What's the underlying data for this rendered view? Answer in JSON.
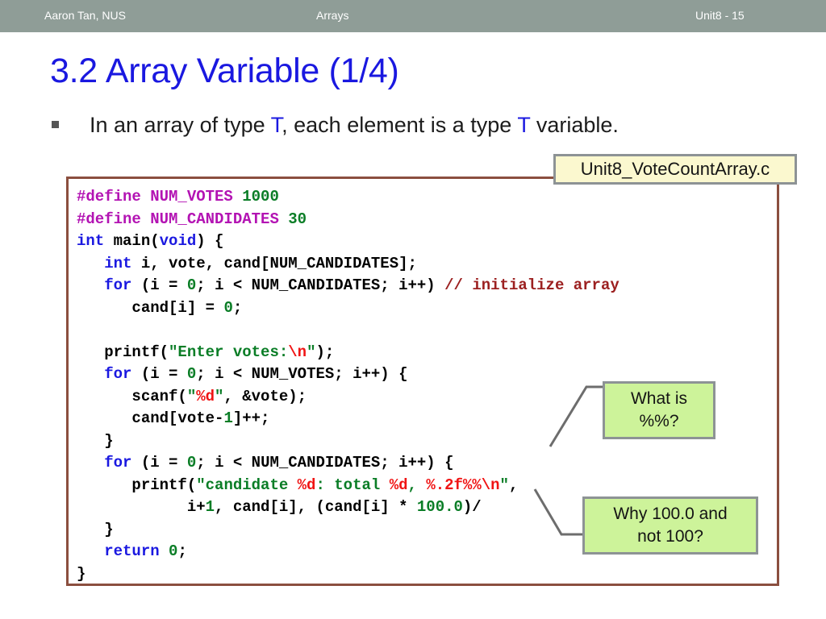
{
  "header": {
    "author": "Aaron Tan, NUS",
    "topic": "Arrays",
    "unit": "Unit8 - 15",
    "bar_color": "#8f9d97"
  },
  "title": {
    "number": "3.2",
    "text": "Array Variable (1/4)",
    "color": "#1a18e0"
  },
  "bullet": {
    "part1": "In an array of type ",
    "type1": "T",
    "part2": ", each element is a type ",
    "type2": "T",
    "part3": " variable.",
    "type_color": "#1a18e0"
  },
  "file_label": {
    "text": "Unit8_VoteCountArray.c",
    "background": "#fbf8cf",
    "border": "#8d9395"
  },
  "code": {
    "border_color": "#8b4f3f",
    "lines": [
      [
        {
          "t": "#define ",
          "c": "tok-pre"
        },
        {
          "t": "NUM_VOTES",
          "c": "tok-macro"
        },
        {
          "t": " ",
          "c": ""
        },
        {
          "t": "1000",
          "c": "tok-num"
        }
      ],
      [
        {
          "t": "#define ",
          "c": "tok-pre"
        },
        {
          "t": "NUM_CANDIDATES",
          "c": "tok-macro"
        },
        {
          "t": " ",
          "c": ""
        },
        {
          "t": "30",
          "c": "tok-num"
        }
      ],
      [
        {
          "t": "int",
          "c": "tok-kw"
        },
        {
          "t": " main(",
          "c": ""
        },
        {
          "t": "void",
          "c": "tok-kw"
        },
        {
          "t": ") {",
          "c": ""
        }
      ],
      [
        {
          "t": "   ",
          "c": ""
        },
        {
          "t": "int",
          "c": "tok-kw"
        },
        {
          "t": " i, vote, cand[NUM_CANDIDATES];",
          "c": ""
        }
      ],
      [
        {
          "t": "   ",
          "c": ""
        },
        {
          "t": "for",
          "c": "tok-kw"
        },
        {
          "t": " (i = ",
          "c": ""
        },
        {
          "t": "0",
          "c": "tok-num"
        },
        {
          "t": "; i < NUM_CANDIDATES; i++) ",
          "c": ""
        },
        {
          "t": "// initialize array",
          "c": "tok-cmt"
        }
      ],
      [
        {
          "t": "      cand[i] = ",
          "c": ""
        },
        {
          "t": "0",
          "c": "tok-num"
        },
        {
          "t": ";",
          "c": ""
        }
      ],
      [
        {
          "t": " ",
          "c": ""
        }
      ],
      [
        {
          "t": "   printf(",
          "c": ""
        },
        {
          "t": "\"Enter votes:",
          "c": "tok-str"
        },
        {
          "t": "\\n",
          "c": "tok-esc"
        },
        {
          "t": "\"",
          "c": "tok-str"
        },
        {
          "t": ");",
          "c": ""
        }
      ],
      [
        {
          "t": "   ",
          "c": ""
        },
        {
          "t": "for",
          "c": "tok-kw"
        },
        {
          "t": " (i = ",
          "c": ""
        },
        {
          "t": "0",
          "c": "tok-num"
        },
        {
          "t": "; i < NUM_VOTES; i++) {",
          "c": ""
        }
      ],
      [
        {
          "t": "      scanf(",
          "c": ""
        },
        {
          "t": "\"",
          "c": "tok-str"
        },
        {
          "t": "%d",
          "c": "tok-esc"
        },
        {
          "t": "\"",
          "c": "tok-str"
        },
        {
          "t": ", &vote);",
          "c": ""
        }
      ],
      [
        {
          "t": "      cand[vote-",
          "c": ""
        },
        {
          "t": "1",
          "c": "tok-num"
        },
        {
          "t": "]++;",
          "c": ""
        }
      ],
      [
        {
          "t": "   }",
          "c": ""
        }
      ],
      [
        {
          "t": "   ",
          "c": ""
        },
        {
          "t": "for",
          "c": "tok-kw"
        },
        {
          "t": " (i = ",
          "c": ""
        },
        {
          "t": "0",
          "c": "tok-num"
        },
        {
          "t": "; i < NUM_CANDIDATES; i++) {",
          "c": ""
        }
      ],
      [
        {
          "t": "      printf(",
          "c": ""
        },
        {
          "t": "\"candidate ",
          "c": "tok-str"
        },
        {
          "t": "%d",
          "c": "tok-esc"
        },
        {
          "t": ": total ",
          "c": "tok-str"
        },
        {
          "t": "%d",
          "c": "tok-esc"
        },
        {
          "t": ", ",
          "c": "tok-str"
        },
        {
          "t": "%.2f%%\\n",
          "c": "tok-esc"
        },
        {
          "t": "\"",
          "c": "tok-str"
        },
        {
          "t": ",",
          "c": ""
        }
      ],
      [
        {
          "t": "            i+",
          "c": ""
        },
        {
          "t": "1",
          "c": "tok-num"
        },
        {
          "t": ", cand[i], (cand[i] * ",
          "c": ""
        },
        {
          "t": "100.0",
          "c": "tok-num"
        },
        {
          "t": ")/",
          "c": ""
        }
      ],
      [
        {
          "t": "   }",
          "c": ""
        }
      ],
      [
        {
          "t": "   ",
          "c": ""
        },
        {
          "t": "return",
          "c": "tok-kw"
        },
        {
          "t": " ",
          "c": ""
        },
        {
          "t": "0",
          "c": "tok-num"
        },
        {
          "t": ";",
          "c": ""
        }
      ],
      [
        {
          "t": "}",
          "c": ""
        }
      ]
    ]
  },
  "callouts": [
    {
      "id": "callout-percent",
      "line1": "What is",
      "line2": "%%?",
      "background": "#cdf39a",
      "border": "#8d9395"
    },
    {
      "id": "callout-hundred",
      "line1": "Why 100.0 and",
      "line2": "not 100?",
      "background": "#cdf39a",
      "border": "#8d9395"
    }
  ]
}
